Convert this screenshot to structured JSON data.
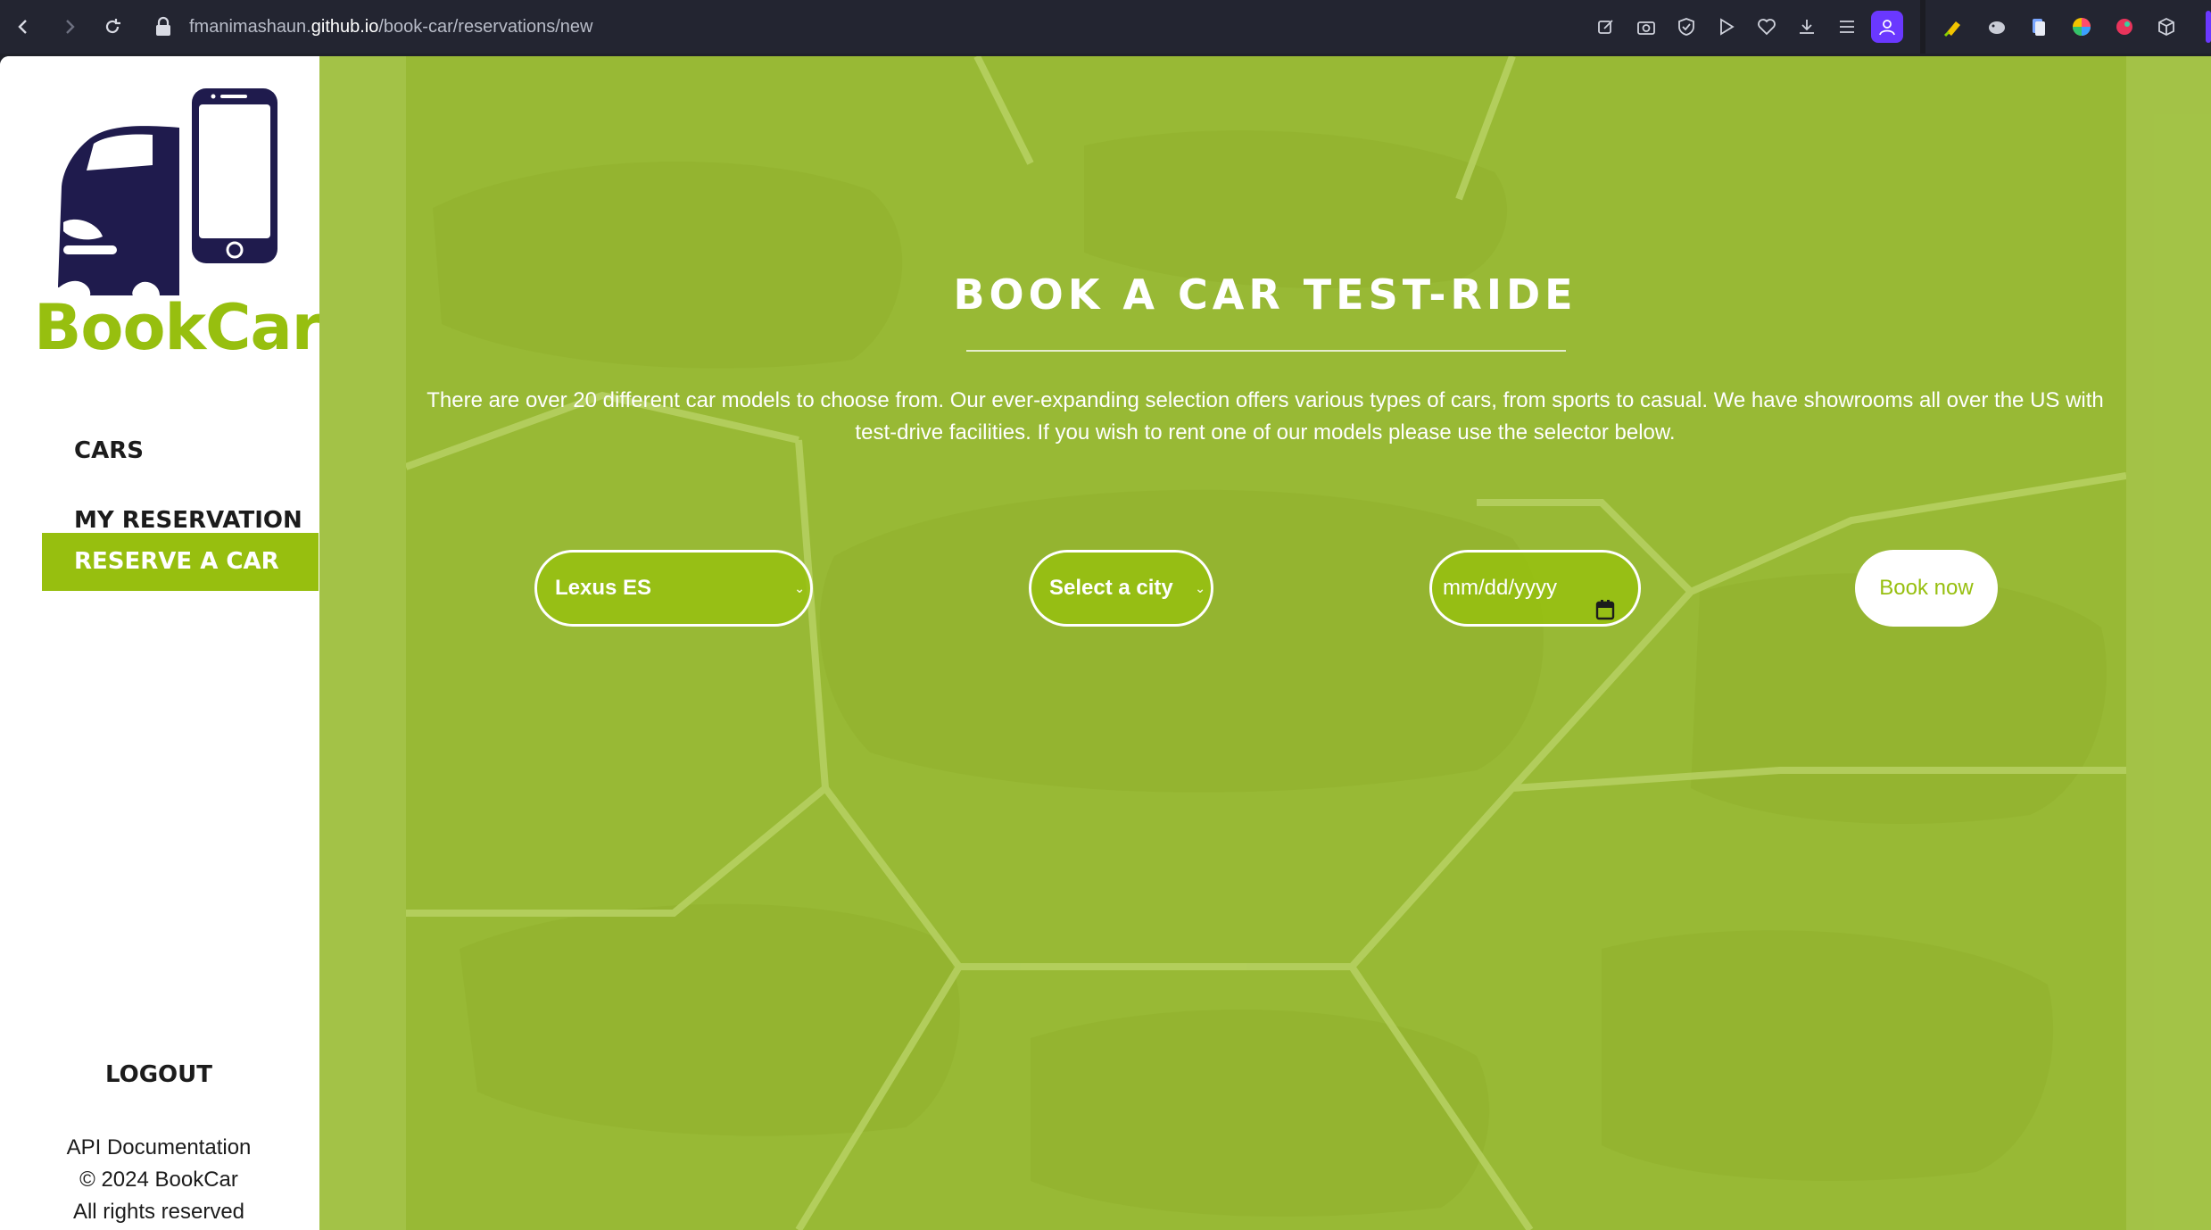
{
  "browser": {
    "url_host_prefix": "fmanimashaun.",
    "url_host": "github.io",
    "url_path": "/book-car/reservations/new"
  },
  "sidebar": {
    "brand": "BookCar",
    "nav": [
      {
        "label": "CARS"
      },
      {
        "label": "MY RESERVATION"
      },
      {
        "label": "RESERVE A CAR"
      }
    ],
    "logout": "LOGOUT",
    "footer": {
      "api_docs": "API Documentation",
      "copyright": "© 2024 BookCar",
      "rights": "All rights reserved"
    }
  },
  "main": {
    "title": "BOOK A CAR TEST-RIDE",
    "intro": "There are over 20 different car models to choose from. Our ever-expanding selection offers various types of cars, from sports to casual. We have showrooms all over the US with test-drive facilities. If you wish to rent one of our models please use the selector below.",
    "form": {
      "car_select_value": "Lexus ES",
      "city_select_value": "Select a city",
      "date_placeholder": "mm/dd/yyyy",
      "submit_label": "Book now"
    }
  },
  "colors": {
    "brand_green": "#97bf0f",
    "brand_navy": "#1f1b4d",
    "main_bg": "#a3c24d"
  }
}
